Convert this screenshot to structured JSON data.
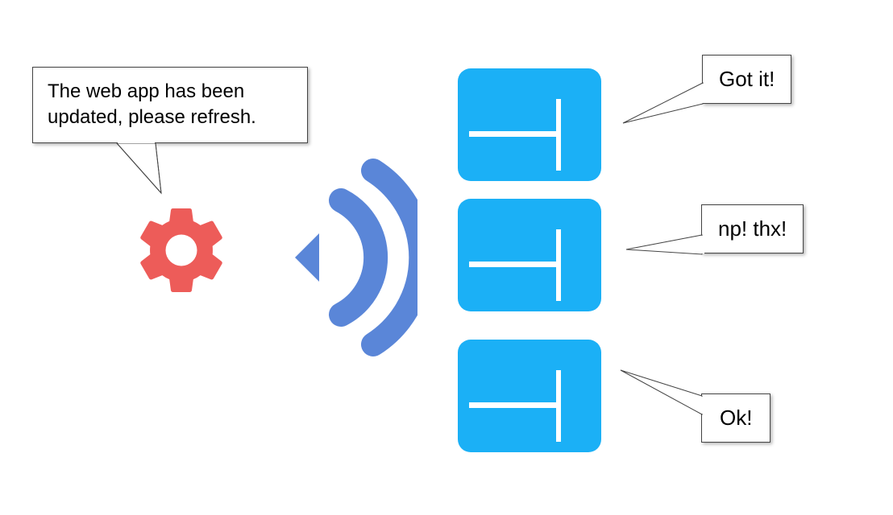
{
  "main_bubble": {
    "text": "The web app has been updated, please refresh."
  },
  "replies": [
    {
      "text": "Got it!"
    },
    {
      "text": "np! thx!"
    },
    {
      "text": "Ok!"
    }
  ],
  "icons": {
    "gear": "gear-icon",
    "broadcast": "broadcast-icon",
    "window": "webpage-icon"
  },
  "colors": {
    "gear": "#ed5c59",
    "broadcast": "#5a86d8",
    "window": "#1bb0f6",
    "bubble_border": "#444444"
  }
}
